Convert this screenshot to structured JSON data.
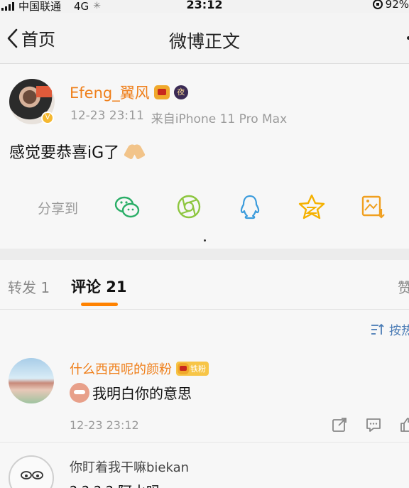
{
  "status_bar": {
    "carrier": "中国联通",
    "network": "4G",
    "time": "23:12",
    "battery": "92%",
    "icons": [
      "signal-bars-icon",
      "loading-icon",
      "orientation-lock-icon"
    ]
  },
  "nav": {
    "back_label": "首页",
    "title": "微博正文"
  },
  "post": {
    "author": "Efeng_翼风",
    "timestamp": "12-23 23:11",
    "source": "来自iPhone 11 Pro Max",
    "text": "感觉要恭喜iG了",
    "badge_night": "夜",
    "share_label": "分享到",
    "share_icons": [
      "wechat-icon",
      "moments-icon",
      "qq-icon",
      "qzone-icon",
      "save-image-icon"
    ]
  },
  "tabs": {
    "repost": "转发 1",
    "comments": "评论 21",
    "likes": "赞"
  },
  "sort": {
    "label": "按热"
  },
  "comments": [
    {
      "name": "什么西西呢的颜粉",
      "fan_badge": "铁粉",
      "text": "我明白你的意思",
      "time": "12-23 23:12"
    },
    {
      "name": "你盯着我干嘛biekan",
      "text": "? ? ? ?   阿水吗"
    }
  ],
  "colors": {
    "accent": "#ff8200",
    "username": "#ef7f1a",
    "wechat": "#2aae67",
    "moments": "#8dc63f",
    "qq": "#3a9bdc",
    "qzone": "#f5b100",
    "save": "#f0a020",
    "link": "#4a7bb5"
  }
}
